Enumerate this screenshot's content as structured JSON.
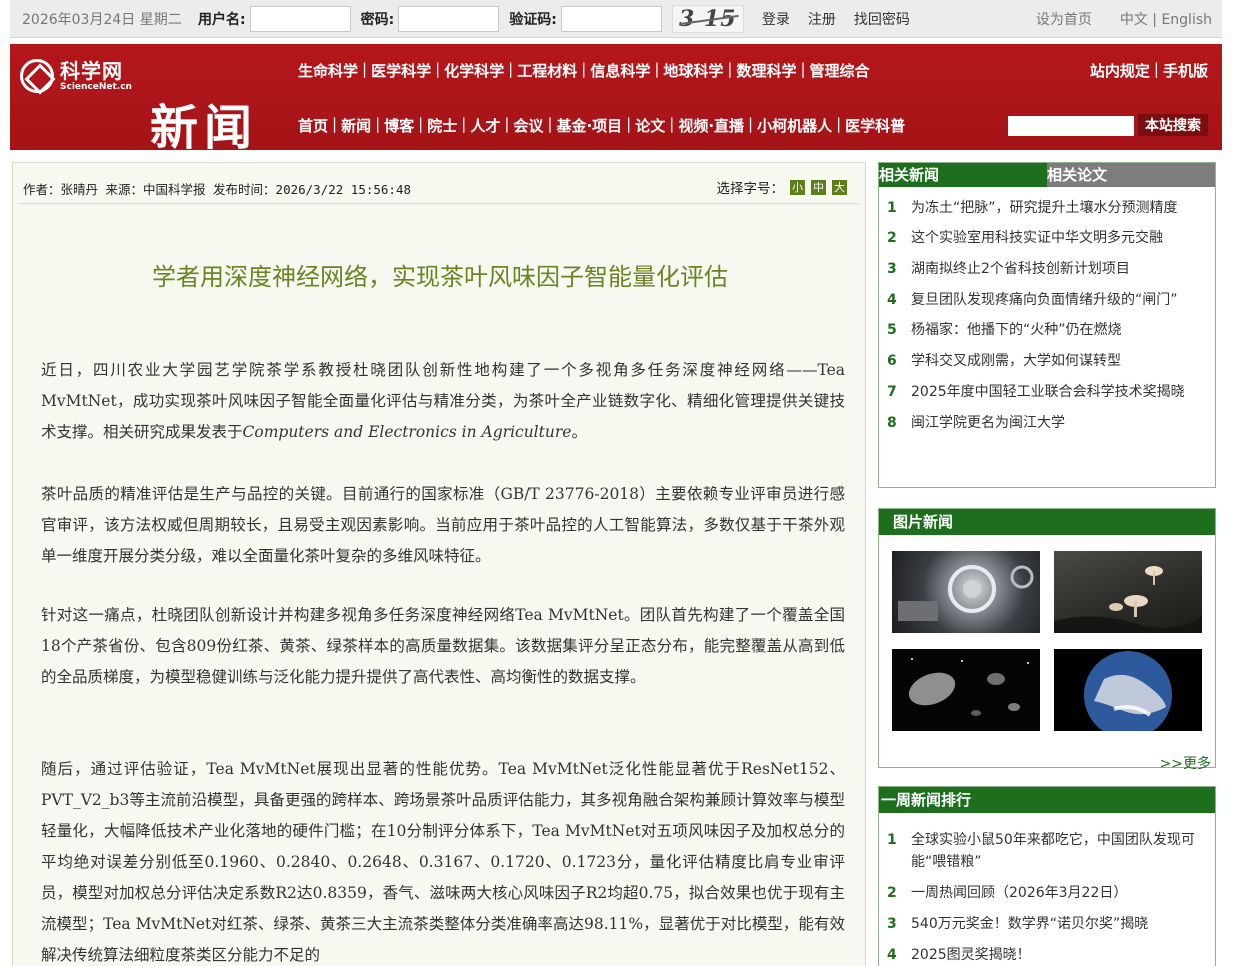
{
  "topbar": {
    "date": "2026年03月24日 星期二",
    "username_label": "用户名:",
    "password_label": "密码:",
    "captcha_label": "验证码:",
    "captcha_text": "3 15",
    "login": "登录",
    "register": "注册",
    "recover": "找回密码",
    "set_home": "设为首页",
    "language": "中文 | English"
  },
  "header": {
    "logo_cn": "科学网",
    "logo_en": "ScienceNet.cn",
    "section_title": "新闻",
    "nav1": [
      "生命科学",
      "医学科学",
      "化学科学",
      "工程材料",
      "信息科学",
      "地球科学",
      "数理科学",
      "管理综合"
    ],
    "nav2": [
      "首页",
      "新闻",
      "博客",
      "院士",
      "人才",
      "会议",
      "基金·项目",
      "论文",
      "视频·直播",
      "小柯机器人",
      "医学科普"
    ],
    "nav_right": [
      "站内规定",
      "手机版"
    ],
    "search_button": "本站搜索"
  },
  "article": {
    "meta": "作者：张晴丹 来源：中国科学报 发布时间：2026/3/22 15:56:48",
    "font_size_label": "选择字号：",
    "font_sizes": [
      "小",
      "中",
      "大"
    ],
    "title": "学者用深度神经网络，实现茶叶风味因子智能量化评估",
    "p1_a": "近日，四川农业大学园艺学院茶学系教授杜晓团队创新性地构建了一个多视角多任务深度神经网络——Tea MvMtNet，成功实现茶叶风味因子智能全面量化评估与精准分类，为茶叶全产业链数字化、精细化管理提供关键技术支撑。相关研究成果发表于",
    "p1_journal": "Computers and Electronics in Agriculture",
    "p1_b": "。",
    "p2": "茶叶品质的精准评估是生产与品控的关键。目前通行的国家标准（GB/T 23776-2018）主要依赖专业评审员进行感官审评，该方法权威但周期较长，且易受主观因素影响。当前应用于茶叶品控的人工智能算法，多数仅基于干茶外观单一维度开展分类分级，难以全面量化茶叶复杂的多维风味特征。",
    "p3": "针对这一痛点，杜晓团队创新设计并构建多视角多任务深度神经网络Tea MvMtNet。团队首先构建了一个覆盖全国18个产茶省份、包含809份红茶、黄茶、绿茶样本的高质量数据集。该数据集评分呈正态分布，能完整覆盖从高到低的全品质梯度，为模型稳健训练与泛化能力提升提供了高代表性、高均衡性的数据支撑。",
    "p4": "随后，通过评估验证，Tea MvMtNet展现出显著的性能优势。Tea MvMtNet泛化性能显著优于ResNet152、PVT_V2_b3等主流前沿模型，具备更强的跨样本、跨场景茶叶品质评估能力，其多视角融合架构兼顾计算效率与模型轻量化，大幅降低技术产业化落地的硬件门槛；在10分制评分体系下，Tea MvMtNet对五项风味因子及加权总分的平均绝对误差分别低至0.1960、0.2840、0.2648、0.3167、0.1720、0.1723分，量化评估精度比肩专业审评员，模型对加权总分评估决定系数R2达0.8359，香气、滋味两大核心风味因子R2均超0.75，拟合效果也优于现有主流模型；Tea MvMtNet对红茶、绿茶、黄茶三大主流茶类整体分类准确率高达98.11%，显著优于对比模型，能有效解决传统算法细粒度茶类区分能力不足的"
  },
  "related": {
    "tab_news": "相关新闻",
    "tab_papers": "相关论文",
    "items": [
      {
        "num": "1",
        "text": "为冻土“把脉”，研究提升土壤水分预测精度"
      },
      {
        "num": "2",
        "text": "这个实验室用科技实证中华文明多元交融"
      },
      {
        "num": "3",
        "text": "湖南拟终止2个省科技创新计划项目"
      },
      {
        "num": "4",
        "text": "复旦团队发现疼痛向负面情绪升级的“闸门”"
      },
      {
        "num": "5",
        "text": "杨福家：他播下的“火种”仍在燃烧"
      },
      {
        "num": "6",
        "text": "学科交叉成刚需，大学如何谋转型"
      },
      {
        "num": "7",
        "text": "2025年度中国轻工业联合会科学技术奖揭晓"
      },
      {
        "num": "8",
        "text": "闽江学院更名为闽江大学"
      }
    ]
  },
  "photos": {
    "heading": "图片新闻",
    "more": ">>更多",
    "images": [
      "machine-photo",
      "mushroom-photo",
      "asteroid-photo",
      "earth-photo"
    ]
  },
  "weekly": {
    "heading": "一周新闻排行",
    "items": [
      {
        "num": "1",
        "text": "全球实验小鼠50年来都吃它，中国团队发现可能“喂错粮”"
      },
      {
        "num": "2",
        "text": "一周热闻回顾（2026年3月22日）"
      },
      {
        "num": "3",
        "text": "540万元奖金！数学界“诺贝尔奖”揭晓"
      },
      {
        "num": "4",
        "text": "2025图灵奖揭晓！"
      }
    ]
  },
  "colors": {
    "header_red": "#b01a1a",
    "accent_green": "#1d6e1d",
    "title_green": "#6a8423"
  }
}
